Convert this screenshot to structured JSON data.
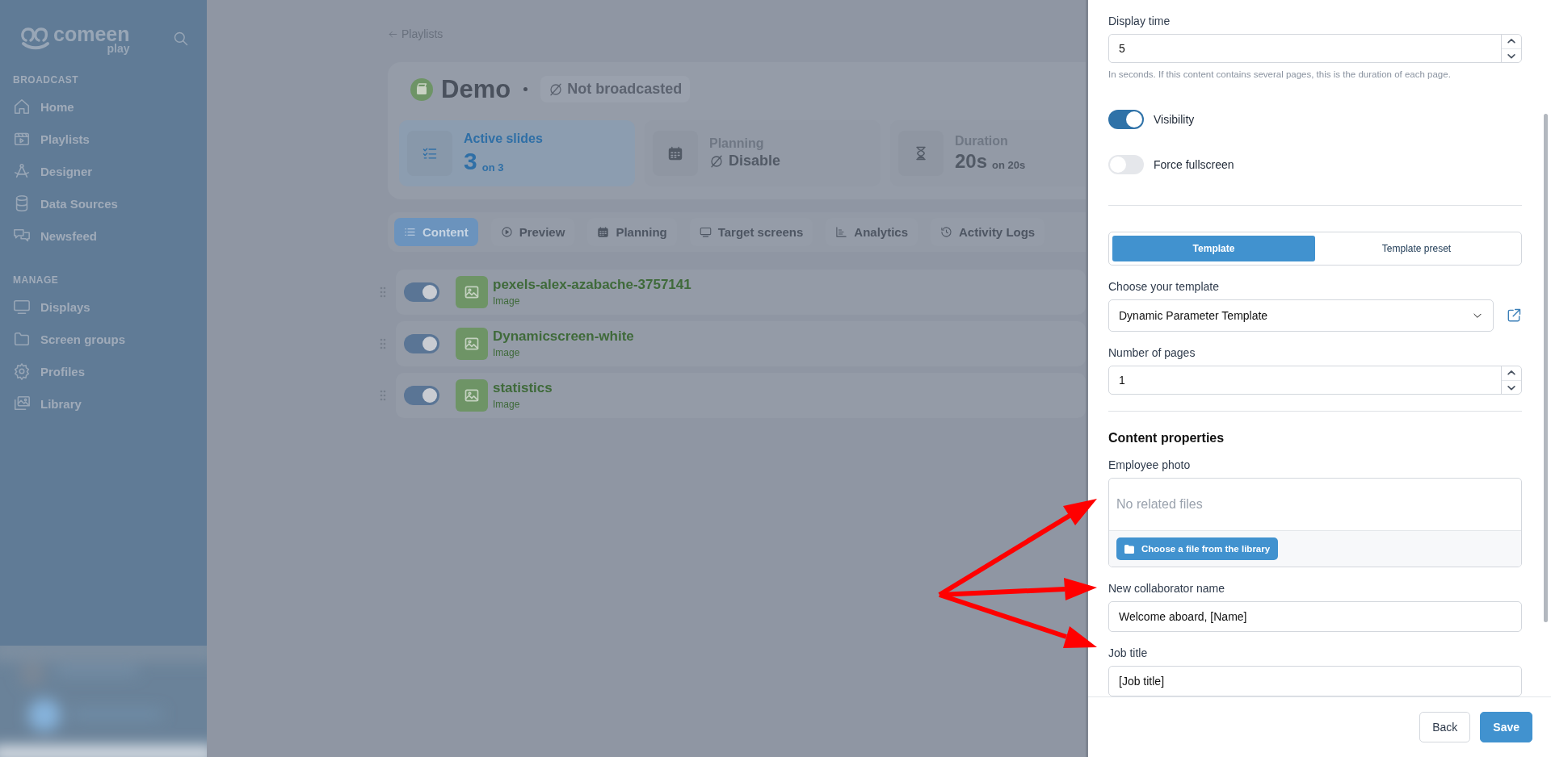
{
  "sidebar": {
    "logo": {
      "name": "comeen",
      "sub": "play"
    },
    "sections": [
      {
        "heading": "BROADCAST",
        "items": [
          {
            "label": "Home"
          },
          {
            "label": "Playlists"
          },
          {
            "label": "Designer"
          },
          {
            "label": "Data Sources"
          },
          {
            "label": "Newsfeed"
          }
        ]
      },
      {
        "heading": "MANAGE",
        "items": [
          {
            "label": "Displays"
          },
          {
            "label": "Screen groups"
          },
          {
            "label": "Profiles"
          },
          {
            "label": "Library"
          }
        ]
      }
    ]
  },
  "main": {
    "back_link": "Playlists",
    "playlist": {
      "title": "Demo",
      "status": "Not broadcasted"
    },
    "stats": [
      {
        "label": "Active slides",
        "value": "3",
        "sub": "on 3",
        "selected": true
      },
      {
        "label": "Planning",
        "value": "Disable",
        "selected": false
      },
      {
        "label": "Duration",
        "value": "20s",
        "sub": "on 20s",
        "selected": false
      }
    ],
    "tabs": [
      {
        "label": "Content",
        "selected": true
      },
      {
        "label": "Preview",
        "selected": false
      },
      {
        "label": "Planning",
        "selected": false
      },
      {
        "label": "Target screens",
        "selected": false
      },
      {
        "label": "Analytics",
        "selected": false
      },
      {
        "label": "Activity Logs",
        "selected": false
      }
    ],
    "content_rows": [
      {
        "name": "pexels-alex-azabache-3757141",
        "type": "Image",
        "enabled": true
      },
      {
        "name": "Dynamicscreen-white",
        "type": "Image",
        "enabled": true
      },
      {
        "name": "statistics",
        "type": "Image",
        "enabled": true
      }
    ]
  },
  "panel": {
    "display_time": {
      "label": "Display time",
      "value": "5",
      "hint": "In seconds. If this content contains several pages, this is the duration of each page."
    },
    "toggles": [
      {
        "label": "Visibility",
        "on": true
      },
      {
        "label": "Force fullscreen",
        "on": false
      }
    ],
    "source_tabs": [
      {
        "label": "Template",
        "selected": true
      },
      {
        "label": "Template preset",
        "selected": false
      }
    ],
    "template": {
      "label": "Choose your template",
      "value": "Dynamic Parameter Template"
    },
    "pages": {
      "label": "Number of pages",
      "value": "1"
    },
    "section_title": "Content properties",
    "properties": [
      {
        "kind": "file",
        "label": "Employee photo",
        "empty_text": "No related files",
        "button": "Choose a file from the library"
      },
      {
        "kind": "text",
        "label": "New collaborator name",
        "value": "Welcome aboard, [Name]"
      },
      {
        "kind": "text",
        "label": "Job title",
        "value": "[Job title]"
      }
    ],
    "buttons": {
      "back": "Back",
      "save": "Save"
    }
  }
}
